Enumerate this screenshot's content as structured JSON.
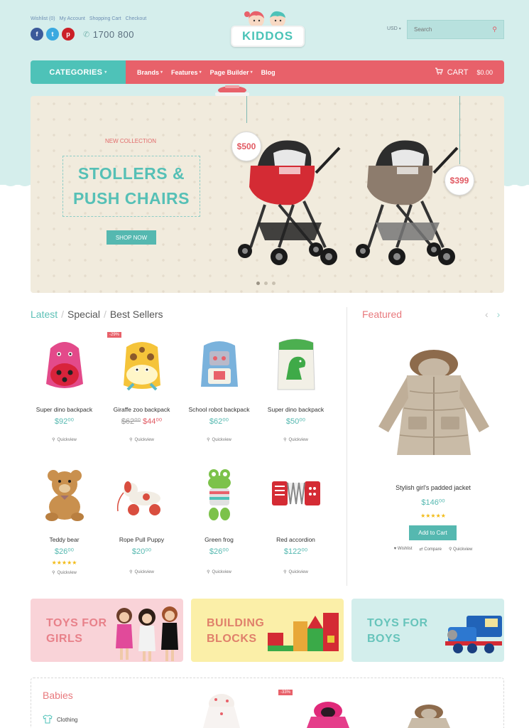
{
  "header": {
    "top_links": [
      "Wishlist (0)",
      "My Account",
      "Shopping Cart",
      "Checkout"
    ],
    "phone": "1700 800",
    "logo_text": "KIDDOS",
    "currency": "USD",
    "search_placeholder": "Search"
  },
  "nav": {
    "categories_label": "CATEGORIES",
    "items": [
      "Brands",
      "Features",
      "Page Builder",
      "Blog"
    ],
    "cart_label": "CART",
    "cart_amount": "$0.00"
  },
  "banner": {
    "kicker": "NEW COLLECTION",
    "headline_line1": "STOLLERS &",
    "headline_line2": "PUSH CHAIRS",
    "button": "SHOP NOW",
    "price_1": "$500",
    "price_2": "$399"
  },
  "products_section": {
    "tab_latest": "Latest",
    "tab_special": "Special",
    "tab_bestsellers": "Best Sellers",
    "sep": "/",
    "quickview": "Quickview",
    "sale_badge": "-29%",
    "items": [
      {
        "name": "Super dino backpack",
        "price": "$92⁰⁰"
      },
      {
        "name": "Giraffe zoo backpack",
        "old_price": "$62⁰⁰",
        "price": "$44⁰⁰"
      },
      {
        "name": "School robot backpack",
        "price": "$62⁰⁰"
      },
      {
        "name": "Super dino backpack",
        "price": "$50⁰⁰"
      },
      {
        "name": "Teddy bear",
        "price": "$26⁰⁰",
        "stars": "★★★★★"
      },
      {
        "name": "Rope Pull Puppy",
        "price": "$20⁰⁰"
      },
      {
        "name": "Green frog",
        "price": "$26⁰⁰"
      },
      {
        "name": "Red accordion",
        "price": "$122⁰⁰"
      }
    ]
  },
  "featured": {
    "title": "Featured",
    "arrow_prev": "‹",
    "arrow_next": "›",
    "name": "Stylish girl's padded jacket",
    "price": "$146⁰⁰",
    "stars": "★★★★★",
    "button": "Add to Cart",
    "action_wishlist": "Wishlist",
    "action_compare": "Compare",
    "action_quickview": "Quickview"
  },
  "promos": [
    {
      "line1": "TOYS FOR",
      "line2": "GIRLS",
      "bg": "#f9d3d8",
      "color": "#e8818a"
    },
    {
      "line1": "BUILDING",
      "line2": "BLOCKS",
      "bg": "#fbefa8",
      "color": "#e0806b"
    },
    {
      "line1": "TOYS FOR",
      "line2": "BOYS",
      "bg": "#d3eeec",
      "color": "#67c4bb"
    }
  ],
  "babies": {
    "title": "Babies",
    "category": "Clothing",
    "sale_badge": "-33%"
  },
  "colors": {
    "accent_teal": "#4ec2b8",
    "accent_red": "#e8616a",
    "header_bg": "#d5eeec",
    "star": "#f2bb16"
  }
}
